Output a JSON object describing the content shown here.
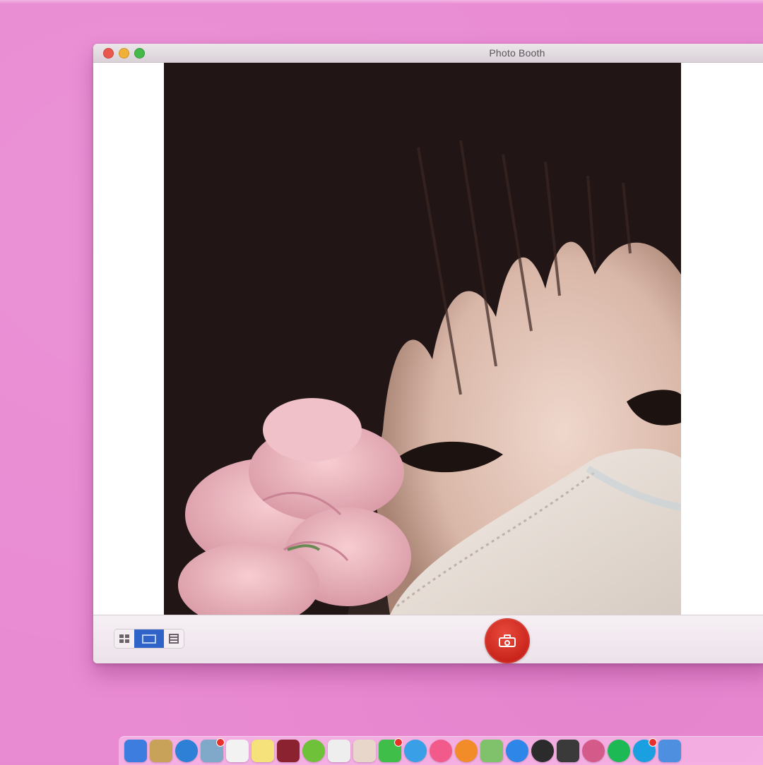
{
  "window": {
    "title": "Photo Booth"
  },
  "toolbar": {
    "views": [
      "grid-view",
      "single-view",
      "filmstrip-view"
    ],
    "active_view": "single-view"
  },
  "dock": {
    "apps": [
      {
        "icon": "finder-icon",
        "color": "#3d7de0"
      },
      {
        "icon": "notes-pad-icon",
        "color": "#c9a25a"
      },
      {
        "icon": "safari-icon",
        "color": "#2e7fd6",
        "round": true
      },
      {
        "icon": "preview-icon",
        "color": "#7fa8c9"
      },
      {
        "icon": "calendar-icon",
        "color": "#f2f2f2"
      },
      {
        "icon": "notes-icon",
        "color": "#f5e27a"
      },
      {
        "icon": "photo-booth-icon",
        "color": "#8a2230"
      },
      {
        "icon": "utorrent-icon",
        "color": "#6fc13a",
        "round": true
      },
      {
        "icon": "textedit-icon",
        "color": "#eeeeee"
      },
      {
        "icon": "photos-icon",
        "color": "#e7d6c9"
      },
      {
        "icon": "facetime-icon",
        "color": "#3fbf4a"
      },
      {
        "icon": "messages-icon",
        "color": "#39a0e8",
        "round": true
      },
      {
        "icon": "itunes-icon",
        "color": "#f25a8c",
        "round": true
      },
      {
        "icon": "books-icon",
        "color": "#f28c28",
        "round": true
      },
      {
        "icon": "maps-icon",
        "color": "#7fc26b"
      },
      {
        "icon": "app-store-icon",
        "color": "#2e86e8",
        "round": true
      },
      {
        "icon": "clock-icon",
        "color": "#2b2b2b",
        "round": true
      },
      {
        "icon": "terminal-icon",
        "color": "#3a3a3a"
      },
      {
        "icon": "flower-app-icon",
        "color": "#d45a8a",
        "round": true
      },
      {
        "icon": "spotify-icon",
        "color": "#1db954",
        "round": true
      },
      {
        "icon": "skype-icon",
        "color": "#1a9fe0",
        "round": true
      },
      {
        "icon": "mail-icon",
        "color": "#4f8fe0"
      }
    ]
  }
}
